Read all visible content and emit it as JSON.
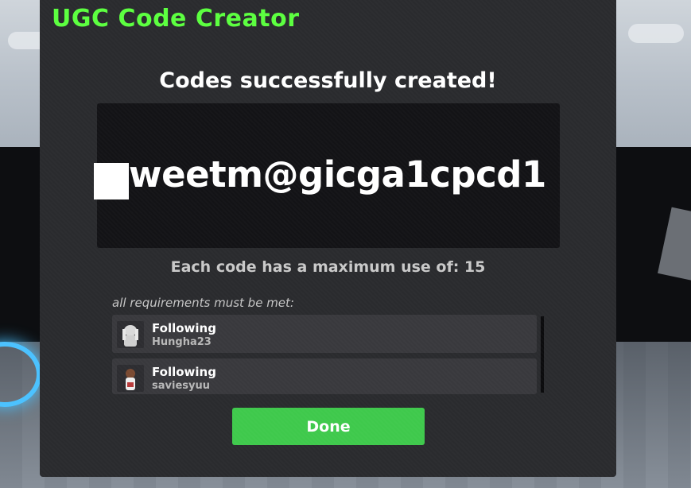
{
  "panel": {
    "title": "UGC Code Creator",
    "headline": "Codes successfully created!",
    "code": "weetm@gicga1cpcd1",
    "max_use_text": "Each code has a maximum use of: 15",
    "requirements_label": "all requirements must be met:",
    "requirements": [
      {
        "type": "Following",
        "user": "Hungha23",
        "avatar_icon": "avatar-thumbnail-icon"
      },
      {
        "type": "Following",
        "user": "saviesyuu",
        "avatar_icon": "avatar-thumbnail-icon"
      }
    ],
    "done_label": "Done"
  },
  "colors": {
    "title": "#5bff3f",
    "panel_bg": "#2a2b2e",
    "code_box_bg": "#131316",
    "done_button": "#3fc94c"
  }
}
